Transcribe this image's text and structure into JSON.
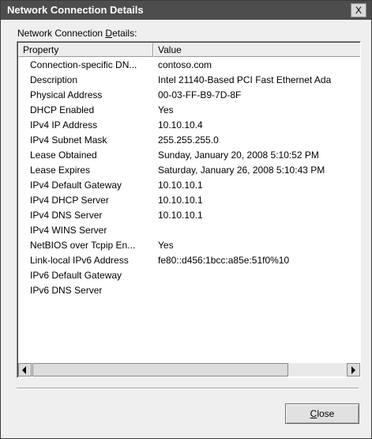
{
  "window": {
    "title": "Network Connection Details",
    "close_glyph": "X"
  },
  "group_label_prefix": "Network Connection ",
  "group_label_accel": "D",
  "group_label_suffix": "etails:",
  "list": {
    "columns": [
      "Property",
      "Value"
    ],
    "rows": [
      {
        "property": "Connection-specific DN...",
        "value": "contoso.com"
      },
      {
        "property": "Description",
        "value": "Intel 21140-Based PCI Fast Ethernet Ada"
      },
      {
        "property": "Physical Address",
        "value": "00-03-FF-B9-7D-8F"
      },
      {
        "property": "DHCP Enabled",
        "value": "Yes"
      },
      {
        "property": "IPv4 IP Address",
        "value": "10.10.10.4"
      },
      {
        "property": "IPv4 Subnet Mask",
        "value": "255.255.255.0"
      },
      {
        "property": "Lease Obtained",
        "value": "Sunday, January 20, 2008 5:10:52 PM"
      },
      {
        "property": "Lease Expires",
        "value": "Saturday, January 26, 2008 5:10:43 PM"
      },
      {
        "property": "IPv4 Default Gateway",
        "value": "10.10.10.1"
      },
      {
        "property": "IPv4 DHCP Server",
        "value": "10.10.10.1"
      },
      {
        "property": "IPv4 DNS Server",
        "value": "10.10.10.1"
      },
      {
        "property": "IPv4 WINS Server",
        "value": ""
      },
      {
        "property": "NetBIOS over Tcpip En...",
        "value": "Yes"
      },
      {
        "property": "Link-local IPv6 Address",
        "value": "fe80::d456:1bcc:a85e:51f0%10"
      },
      {
        "property": "IPv6 Default Gateway",
        "value": ""
      },
      {
        "property": "IPv6 DNS Server",
        "value": ""
      }
    ]
  },
  "buttons": {
    "close_accel": "C",
    "close_rest": "lose"
  },
  "icons": {
    "close": "close-icon",
    "scroll_left": "chevron-left-icon",
    "scroll_right": "chevron-right-icon"
  },
  "colors": {
    "titlebar": "#4d4d4d",
    "dialog_bg": "#efefef",
    "list_bg": "#ffffff"
  }
}
